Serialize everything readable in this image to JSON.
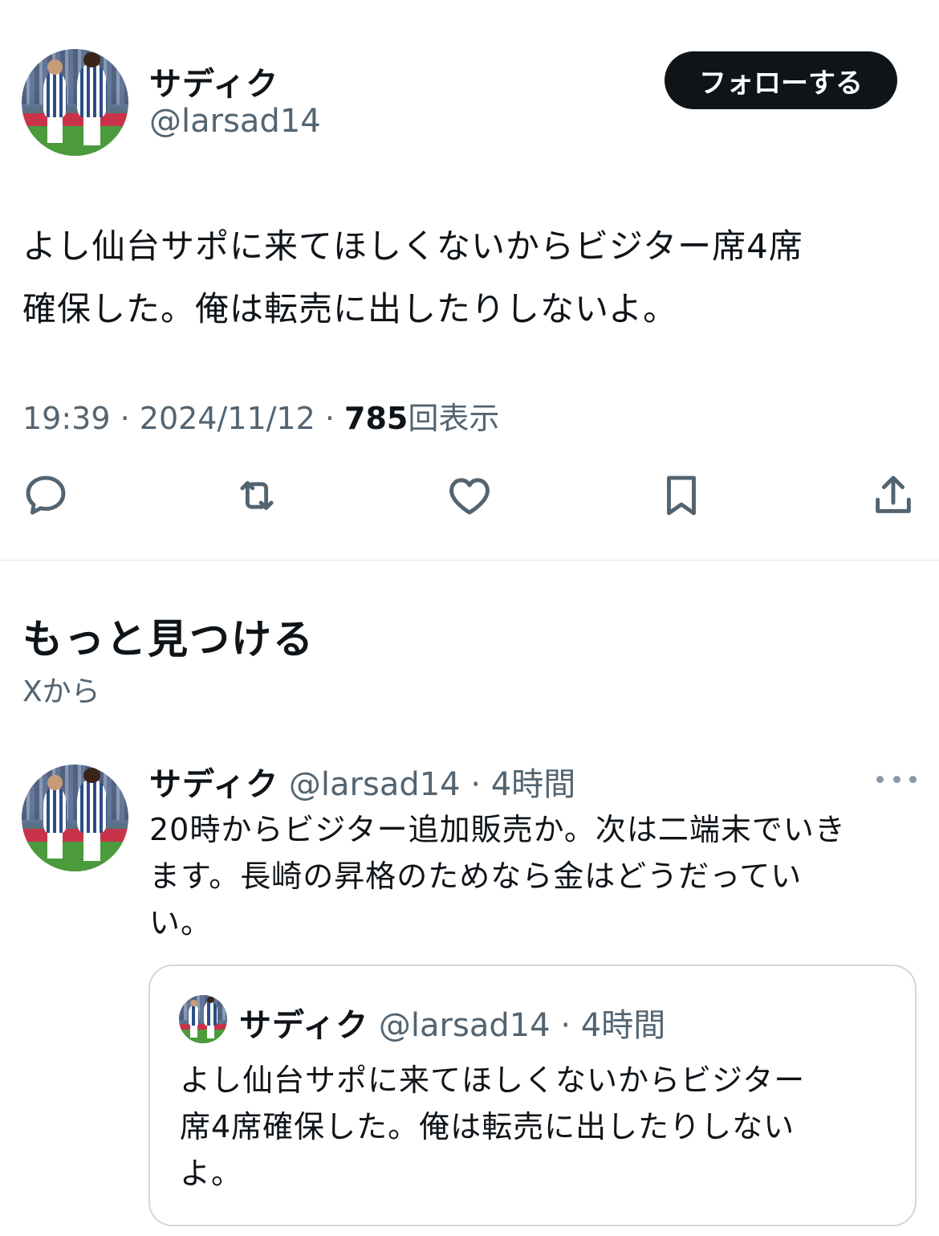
{
  "tweet": {
    "author_name": "サディク",
    "author_handle": "@larsad14",
    "follow_label": "フォローする",
    "text_line1": "よし仙台サポに来てほしくないからビジター席4席",
    "text_line2": "確保した。俺は転売に出したりしないよ。",
    "time": "19:39",
    "date": "2024/11/12",
    "views_count": "785",
    "views_label": "回表示",
    "separator": " · "
  },
  "actions": [
    {
      "icon": "reply-icon"
    },
    {
      "icon": "retweet-icon"
    },
    {
      "icon": "like-icon"
    },
    {
      "icon": "bookmark-icon"
    },
    {
      "icon": "share-icon"
    }
  ],
  "discover": {
    "title": "もっと見つける",
    "subtitle": "Xから"
  },
  "recommended": {
    "author_name": "サディク",
    "author_handle": "@larsad14",
    "time_ago": "4時間",
    "separator": " · ",
    "text_line1": "20時からビジター追加販売か。次は二端末でいき",
    "text_line2": "ます。長崎の昇格のためなら金はどうだってい",
    "text_line3": "い。",
    "quote": {
      "author_name": "サディク",
      "author_handle": "@larsad14",
      "time_ago": "4時間",
      "separator": " · ",
      "text_line1": "よし仙台サポに来てほしくないからビジター",
      "text_line2": "席4席確保した。俺は転売に出したりしない",
      "text_line3": "よ。"
    }
  },
  "colors": {
    "text_primary": "#0f1419",
    "text_secondary": "#536471",
    "button_bg": "#0f1419",
    "border": "#cfd9de"
  }
}
